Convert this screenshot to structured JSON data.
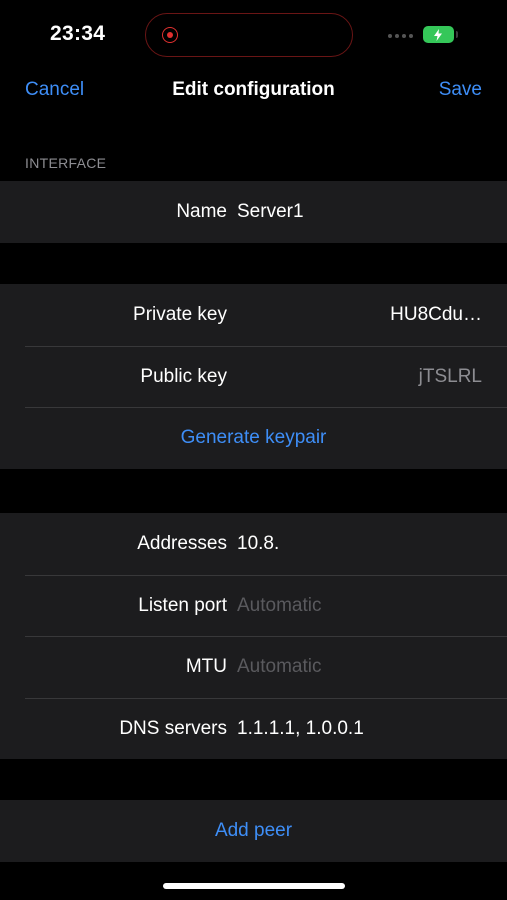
{
  "status_bar": {
    "time": "23:34",
    "battery_color": "#35c759",
    "recording_color": "#e0302f"
  },
  "nav": {
    "cancel_label": "Cancel",
    "title": "Edit configuration",
    "save_label": "Save",
    "accent_color": "#3e8ef7"
  },
  "interface": {
    "section_label": "INTERFACE",
    "name_label": "Name",
    "name_value": "Server1",
    "private_key_label": "Private key",
    "private_key_value": "HU8Cdu…",
    "public_key_label": "Public key",
    "public_key_value": "jTSLRL",
    "generate_keypair_label": "Generate keypair",
    "addresses_label": "Addresses",
    "addresses_value": "10.8.",
    "listen_port_label": "Listen port",
    "listen_port_placeholder": "Automatic",
    "mtu_label": "MTU",
    "mtu_placeholder": "Automatic",
    "dns_label": "DNS servers",
    "dns_value": "1.1.1.1, 1.0.0.1"
  },
  "peers": {
    "add_peer_label": "Add peer"
  }
}
